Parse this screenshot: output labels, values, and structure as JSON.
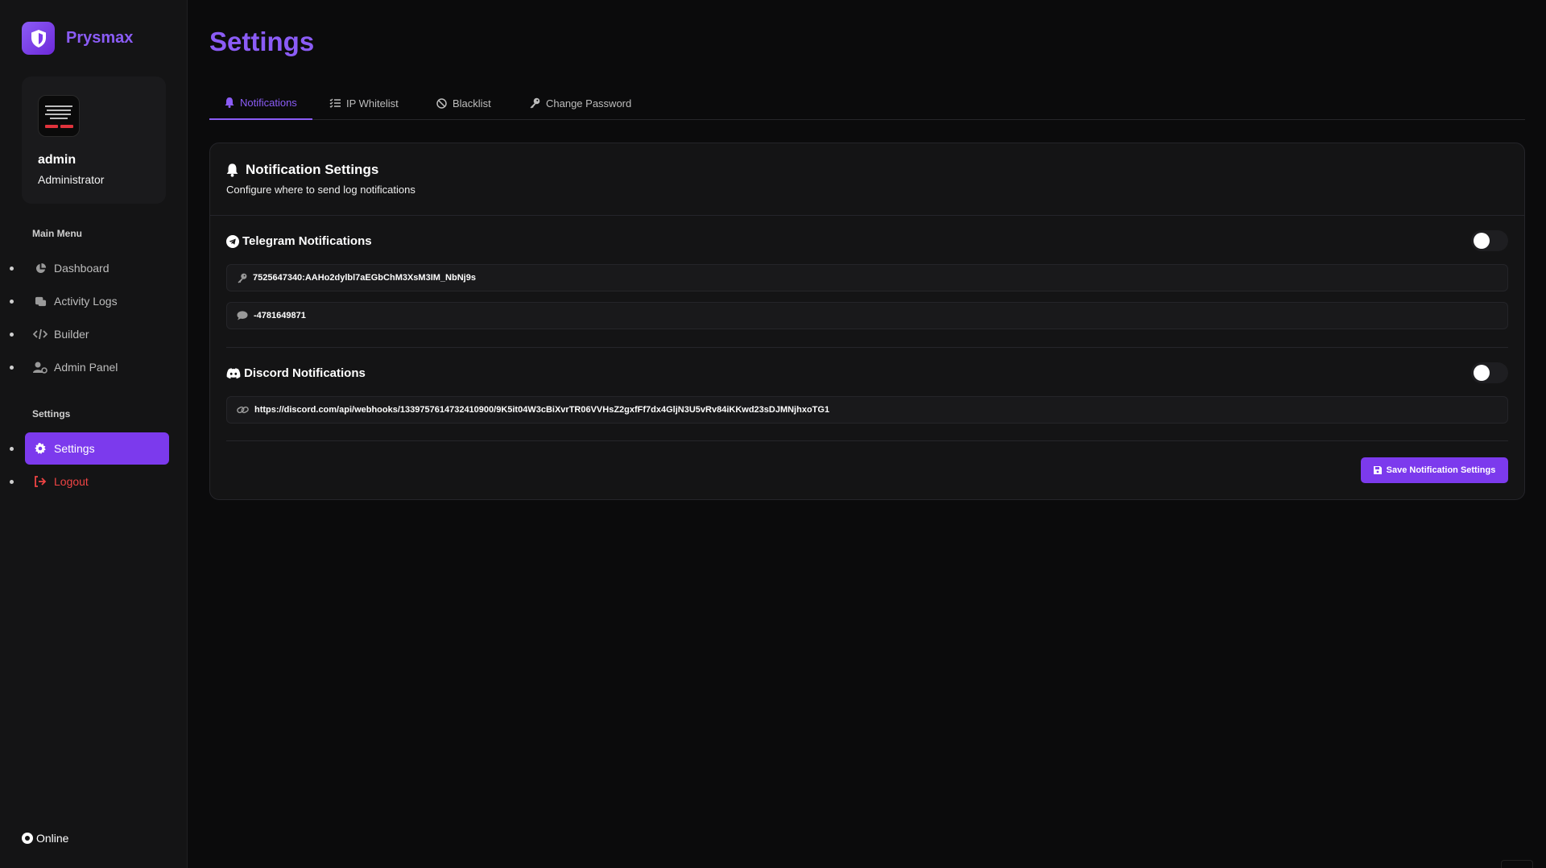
{
  "brand": {
    "name": "Prysmax",
    "icon": "shield-icon"
  },
  "profile": {
    "name": "admin",
    "role": "Administrator"
  },
  "sidebar": {
    "main_menu_label": "Main Menu",
    "items": [
      {
        "label": "Dashboard",
        "icon": "pie-chart-icon"
      },
      {
        "label": "Activity Logs",
        "icon": "scroll-icon"
      },
      {
        "label": "Builder",
        "icon": "code-icon"
      },
      {
        "label": "Admin Panel",
        "icon": "user-gear-icon"
      }
    ],
    "settings_label": "Settings",
    "settings_items": [
      {
        "label": "Settings",
        "icon": "gear-icon",
        "active": true
      },
      {
        "label": "Logout",
        "icon": "sign-out-icon"
      }
    ]
  },
  "status": {
    "label": "Online"
  },
  "page": {
    "title": "Settings"
  },
  "tabs": [
    {
      "label": "Notifications",
      "icon": "bell-icon",
      "active": true
    },
    {
      "label": "IP Whitelist",
      "icon": "list-check-icon"
    },
    {
      "label": "Blacklist",
      "icon": "ban-icon"
    },
    {
      "label": "Change Password",
      "icon": "key-icon"
    }
  ],
  "notification_card": {
    "title": "Notification Settings",
    "subtitle": "Configure where to send log notifications",
    "telegram": {
      "title": "Telegram Notifications",
      "enabled": false,
      "bot_token": "7525647340:AAHo2dylbl7aEGbChM3XsM3IM_NbNj9s",
      "chat_id": "-4781649871"
    },
    "discord": {
      "title": "Discord Notifications",
      "enabled": false,
      "webhook_url": "https://discord.com/api/webhooks/1339757614732410900/9K5it04W3cBiXvrTR06VVHsZ2gxfFf7dx4GljN3U5vRv84iKKwd23sDJMNjhxoTG1"
    },
    "save_label": "Save Notification Settings"
  },
  "colors": {
    "accent": "#8b5cf6",
    "accent_button": "#7c3aed",
    "danger": "#ef4444",
    "background": "#0b0b0c",
    "panel": "#141415"
  }
}
